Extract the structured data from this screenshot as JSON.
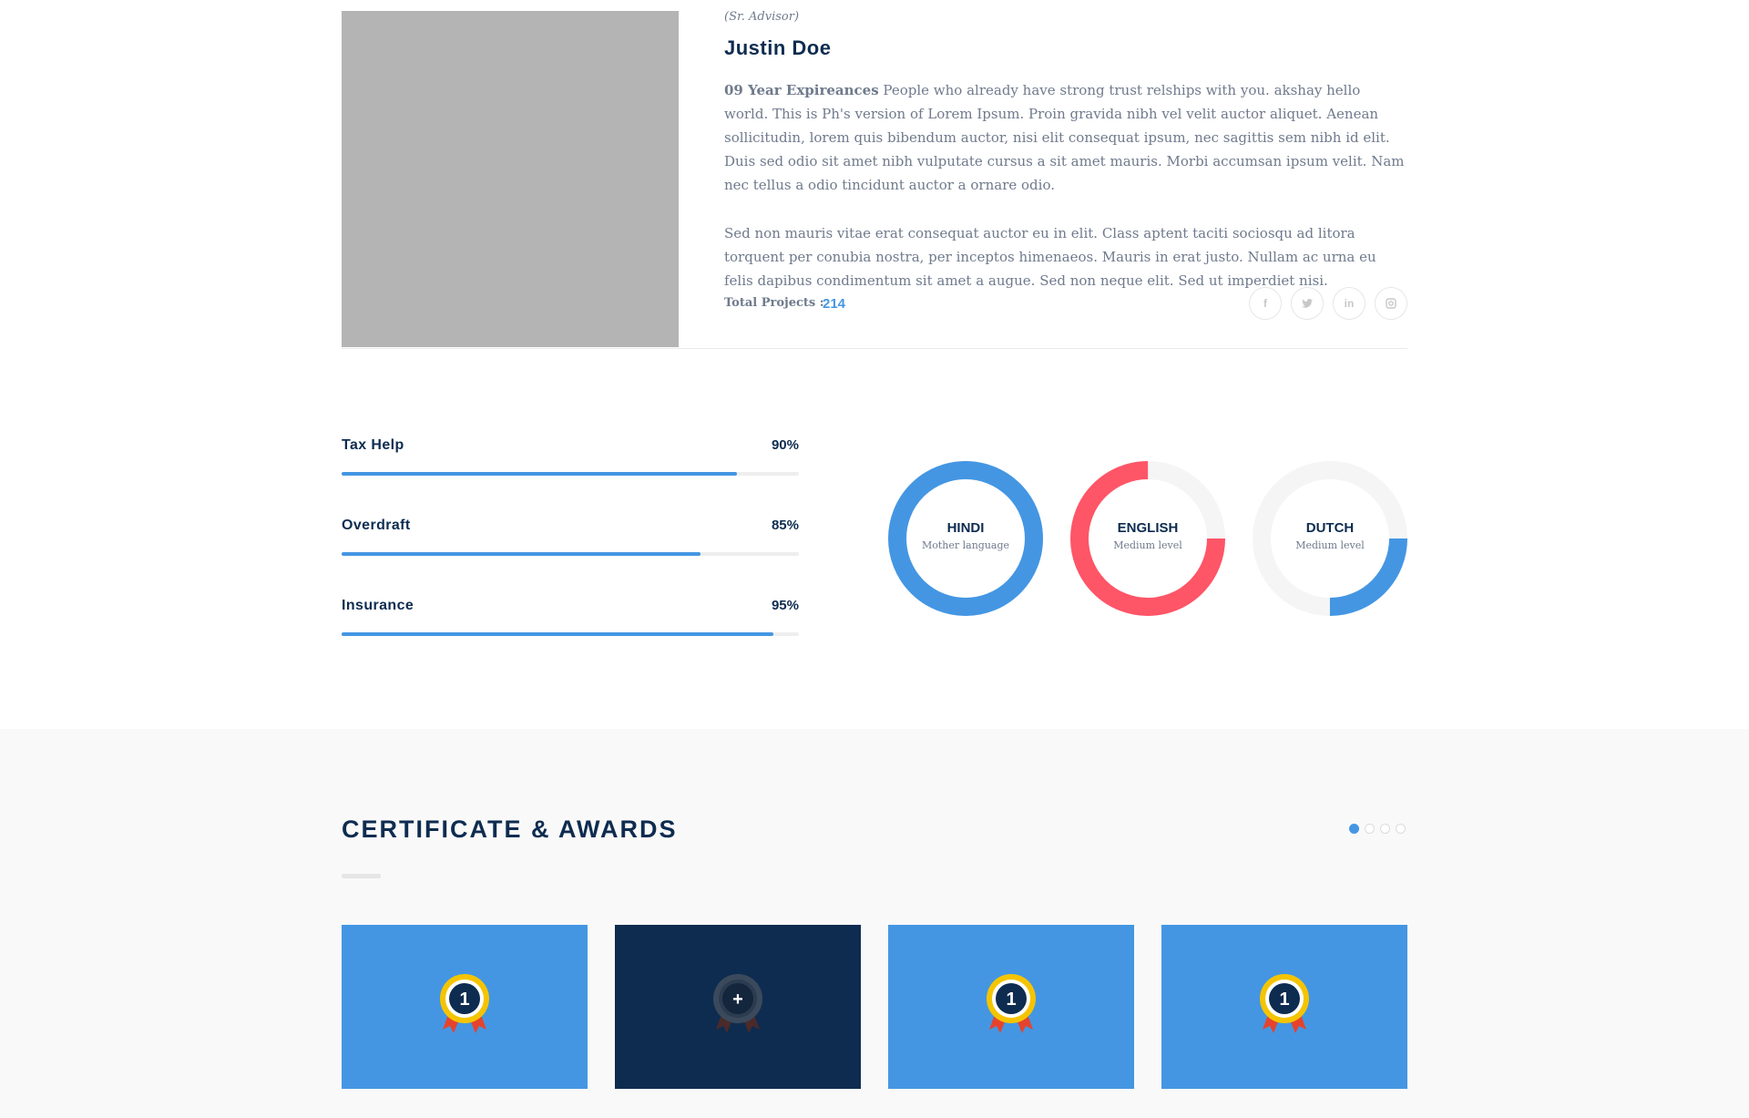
{
  "profile": {
    "role": "(Sr. Advisor)",
    "name": "Justin Doe",
    "experience": "09 Year Expireances",
    "bio_1": " People who already have strong trust relships with you. akshay hello world. This is Ph's version  of Lorem Ipsum. Proin gravida nibh vel velit auctor aliquet. Aenean sollicitudin, lorem quis bibendum auctor, nisi elit consequat ipsum, nec sagittis sem nibh id elit. Duis sed odio sit amet nibh vulputate cursus a sit amet mauris. Morbi accumsan ipsum velit. Nam nec tellus a odio tincidunt auctor a ornare odio.",
    "bio_2": "Sed non  mauris vitae erat consequat auctor eu in elit. Class aptent taciti sociosqu ad litora torquent per conubia nostra, per inceptos himenaeos. Mauris in erat justo. Nullam ac urna eu felis dapibus condimentum sit amet a augue. Sed non neque elit. Sed ut imperdiet nisi.",
    "total_projects_label": "Total Projects :",
    "total_projects_value": "214",
    "socials": [
      {
        "icon": "facebook-icon",
        "glyph": "f"
      },
      {
        "icon": "twitter-icon",
        "glyph": "t"
      },
      {
        "icon": "linkedin-icon",
        "glyph": "in"
      },
      {
        "icon": "instagram-icon",
        "glyph": "◻"
      }
    ]
  },
  "skills": [
    {
      "title": "Tax Help",
      "percent_label": "90%",
      "value": 0.865
    },
    {
      "title": "Overdraft",
      "percent_label": "85%",
      "value": 0.785
    },
    {
      "title": "Insurance",
      "percent_label": "95%",
      "value": 0.945
    }
  ],
  "languages": [
    {
      "name": "HINDI",
      "level": "Mother language",
      "value": 1.0,
      "color": "#4496e3"
    },
    {
      "name": "ENGLISH",
      "level": "Medium level",
      "value": 0.75,
      "color": "#fe5567"
    },
    {
      "name": "DUTCH",
      "level": "Medium level",
      "value": 0.25,
      "color": "#4496e3"
    }
  ],
  "certificates": {
    "title": "CERTIFICATE & AWARDS",
    "pager": {
      "count": 4,
      "active": 0
    },
    "cards": [
      {
        "style": "blue",
        "icon": "award-medal-icon",
        "number": "1"
      },
      {
        "style": "dark",
        "icon": "award-medal-plus-icon",
        "number": "+"
      },
      {
        "style": "blue",
        "icon": "award-medal-icon",
        "number": "1"
      },
      {
        "style": "blue",
        "icon": "award-medal-icon",
        "number": "1"
      }
    ]
  },
  "colors": {
    "navy": "#0e2c50",
    "accent_blue": "#4496e3",
    "accent_red": "#fe5567",
    "text_gray": "#6f7a8c"
  }
}
